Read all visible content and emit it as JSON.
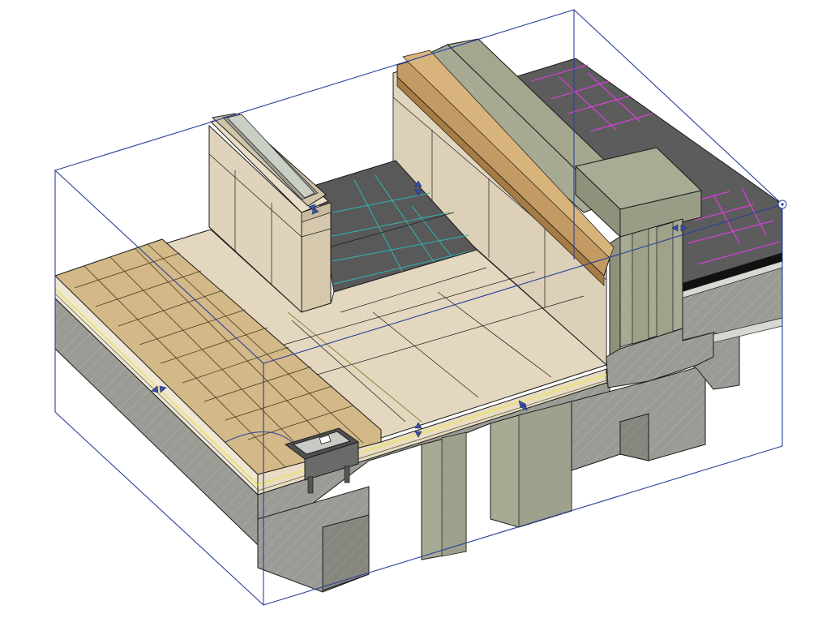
{
  "view": {
    "type": "3d-section-detail",
    "colors": {
      "tile": "#d3b888",
      "tile_joint": "#4a3c22",
      "membrane": "#c9bfa4",
      "screed": "#e2d6bf",
      "concrete": "#9b9b95",
      "concrete_dark": "#7e7e79",
      "insulation": "#a7aa92",
      "insulation_dark": "#8d9079",
      "wall_panel": "#ddd0b8",
      "wall_panel_shade": "#cbbd9f",
      "timber": "#c39a63",
      "roof_dark": "#5b5b5b",
      "roof_grid_cyan": "#2eb6b6",
      "roof_grid_magenta": "#e83ce8",
      "yellow_layer": "#e9e27a",
      "section_box": "#2a3f9a"
    }
  }
}
